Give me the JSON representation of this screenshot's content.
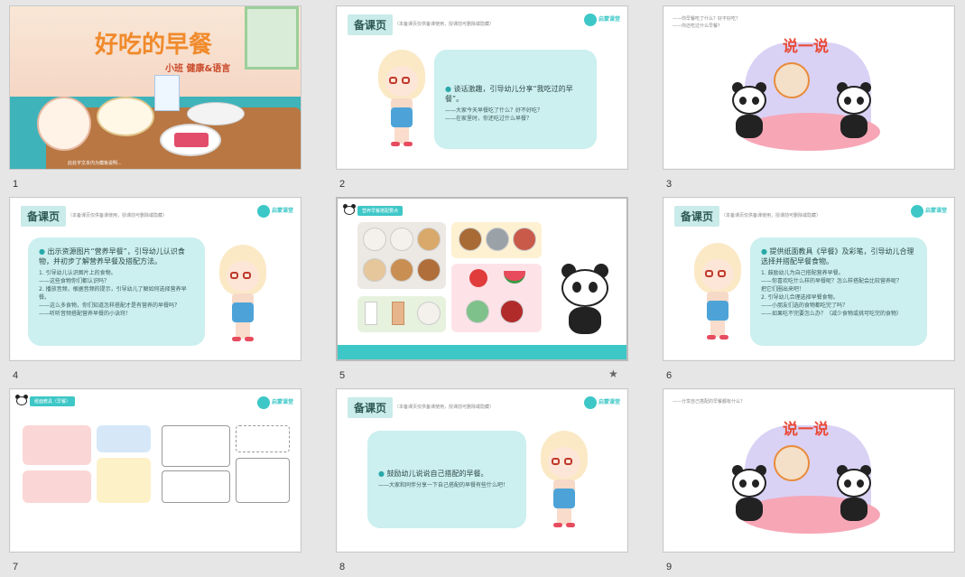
{
  "slides": [
    {
      "num": "1",
      "title": "好吃的早餐",
      "subtitle": "小班  健康&语言",
      "footnote": "此处字文本内为模板说明..."
    },
    {
      "num": "2",
      "tag": "备课页",
      "tagnote": "（本备课页仅供备课使用，授课前可删除或隐藏）",
      "logo": "启蒙课堂",
      "head": "谈话激趣，引导幼儿分享“我吃过的早餐”。",
      "lines": [
        "——大家今天早餐吃了什么？好不好吃？",
        "——在家里时，你还吃过什么早餐？"
      ]
    },
    {
      "num": "3",
      "title": "说一说",
      "notes": [
        "——你早餐吃了什么？好不好吃？",
        "——你还吃过什么早餐？"
      ]
    },
    {
      "num": "4",
      "tag": "备课页",
      "tagnote": "（本备课页仅供备课使用，授课前可删除或隐藏）",
      "logo": "启蒙课堂",
      "head": "出示资源图片“营养早餐”，引导幼儿认识食物，并初步了解营养早餐及搭配方法。",
      "lines": [
        "1. 引导幼儿认识图片上的食物。",
        "——这些食物你们都认识吗？",
        "2. 播放音频，根据音频的提示，引导幼儿了解如何选择营养早餐。",
        "——这么多食物，你们知道怎样搭配才是有营养的早餐吗？",
        "——听听音频搭配营养早餐的小诀窍！"
      ]
    },
    {
      "num": "5",
      "tag": "营养早餐搭配要点",
      "star": "★"
    },
    {
      "num": "6",
      "tag": "备课页",
      "tagnote": "（本备课页仅供备课使用，授课前可删除或隐藏）",
      "logo": "启蒙课堂",
      "head": "提供纸面教具《早餐》及彩笔，引导幼儿合理选择并搭配早餐食物。",
      "lines": [
        "1. 鼓励幼儿为自己搭配营养早餐。",
        "——你喜欢吃什么样的早餐呢？怎么样搭配会比较营养呢？",
        "把它们圈出来吧！",
        "2. 引导幼儿合理选择早餐食物。",
        "——小朋友们选的食物都吃完了吗？",
        "——如果吃不完要怎么办？（减少食物或挑可吃完的食物）"
      ]
    },
    {
      "num": "7",
      "tag": "纸面教具（早餐）",
      "logo": "启蒙课堂"
    },
    {
      "num": "8",
      "tag": "备课页",
      "tagnote": "（本备课页仅供备课使用，授课前可删除或隐藏）",
      "logo": "启蒙课堂",
      "head": "鼓励幼儿说说自己搭配的早餐。",
      "lines": [
        "——大家和同伴分享一下自己搭配的早餐有些什么吧！"
      ]
    },
    {
      "num": "9",
      "title": "说一说",
      "notes": [
        "——分享自己搭配的早餐都有什么？"
      ]
    }
  ],
  "colors": {
    "teal": "#3ec7c7",
    "bubble": "#ccefef",
    "orange": "#f08a2b",
    "pink": "#f7a6b6"
  }
}
